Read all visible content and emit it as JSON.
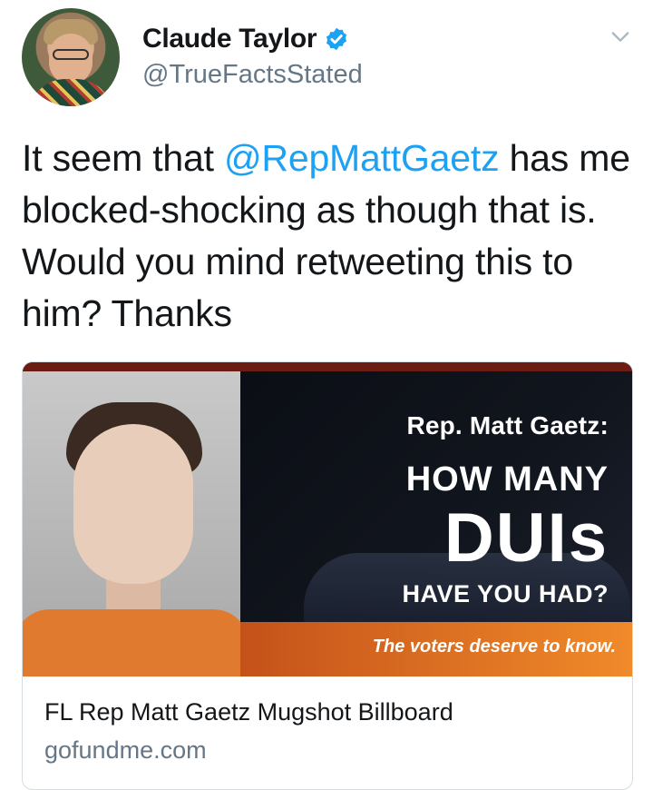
{
  "author": {
    "name": "Claude Taylor",
    "handle": "@TrueFactsStated",
    "verified": true
  },
  "tweet": {
    "mention": "@RepMattGaetz",
    "text_before": "It seem that ",
    "text_after": " has me blocked-shocking as though that is. Would you mind retweeting this to him? Thanks"
  },
  "card": {
    "billboard": {
      "line1": "Rep. Matt Gaetz:",
      "line2": "HOW MANY",
      "line3": "DUIs",
      "line4": "HAVE YOU HAD?",
      "tagline": "The voters deserve to know."
    },
    "title": "FL Rep Matt Gaetz Mugshot Billboard",
    "domain": "gofundme.com"
  },
  "icons": {
    "verified": "verified-badge-icon",
    "menu": "chevron-down-icon"
  },
  "colors": {
    "link": "#1da1f2",
    "muted": "#657786",
    "text": "#14171a",
    "verified": "#1da1f2"
  }
}
